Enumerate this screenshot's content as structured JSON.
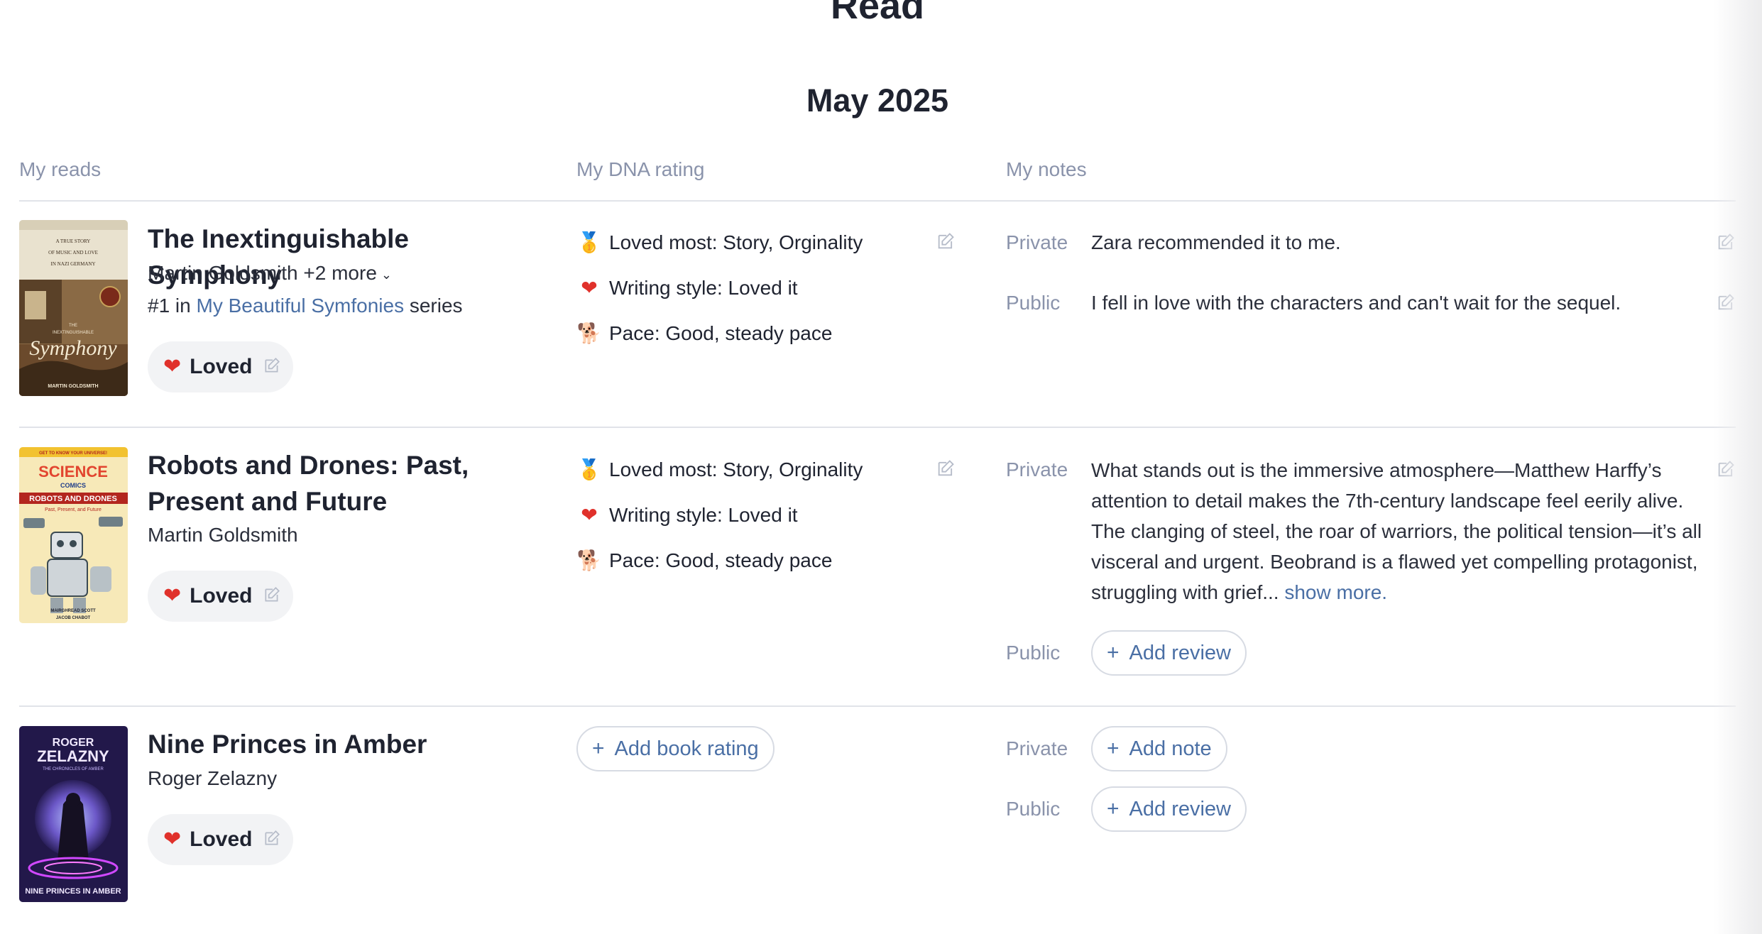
{
  "page": {
    "title": "Read",
    "month": "May 2025"
  },
  "columns": {
    "reads": "My reads",
    "dna": "My DNA rating",
    "notes": "My notes"
  },
  "colors": {
    "accent_link": "#4a6fa5",
    "heart": "#e0312b",
    "muted": "#8a93ab",
    "divider": "#e1e3e9"
  },
  "books": [
    {
      "title": "The Inextinguishable Symphony",
      "author": "Martin Goldsmith +2 more",
      "series_prefix": "#1 in ",
      "series_link": "My Beautiful Symfonies",
      "series_suffix": " series",
      "status": "Loved",
      "dna": [
        {
          "icon": "medal-icon",
          "text": "Loved most: Story, Orginality"
        },
        {
          "icon": "heart-icon",
          "text": "Writing style: Loved it"
        },
        {
          "icon": "dog-icon",
          "text": "Pace: Good, steady pace"
        }
      ],
      "private_label": "Private",
      "private_note": "Zara recommended it to me.",
      "public_label": "Public",
      "public_note": "I fell in love with the characters and can't wait for the sequel."
    },
    {
      "title": "Robots and Drones: Past, Present and Future",
      "author": "Martin Goldsmith",
      "status": "Loved",
      "dna": [
        {
          "icon": "medal-icon",
          "text": "Loved most: Story, Orginality"
        },
        {
          "icon": "heart-icon",
          "text": "Writing style: Loved it"
        },
        {
          "icon": "dog-icon",
          "text": "Pace: Good, steady pace"
        }
      ],
      "private_label": "Private",
      "private_note": "What stands out is the immersive atmosphere—Matthew Harffy’s attention to detail makes the 7th-century landscape feel eerily alive. The clanging of steel, the roar of warriors, the political tension—it’s all visceral and urgent. Beobrand is a flawed yet compelling protagonist, struggling with grief...",
      "show_more": "show more.",
      "public_label": "Public",
      "public_action": "Add review"
    },
    {
      "title": "Nine Princes in Amber",
      "author": "Roger Zelazny",
      "status": "Loved",
      "dna_action": "Add book rating",
      "private_label": "Private",
      "private_action": "Add note",
      "public_label": "Public",
      "public_action": "Add review"
    }
  ],
  "covers": {
    "symphony": {
      "top_lines": [
        "A TRUE STORY",
        "OF MUSIC AND LOVE",
        "IN NAZI GERMANY"
      ],
      "the": "THE",
      "title_word": "INEXTINGUISHABLE",
      "script": "Symphony",
      "author": "MARTIN GOLDSMITH"
    },
    "robots": {
      "banner": "GET TO KNOW YOUR UNIVERSE!",
      "science": "SCIENCE",
      "comics": "COMICS",
      "title": "ROBOTS AND DRONES",
      "subtitle": "Past, Present, and Future",
      "authors": [
        "MAIRGHREAD SCOTT",
        "JACOB CHABOT"
      ]
    },
    "amber": {
      "author_top": "ROGER",
      "author_bottom": "ZELAZNY",
      "series": "THE CHRONICLES OF AMBER",
      "title": "NINE PRINCES IN AMBER"
    }
  }
}
